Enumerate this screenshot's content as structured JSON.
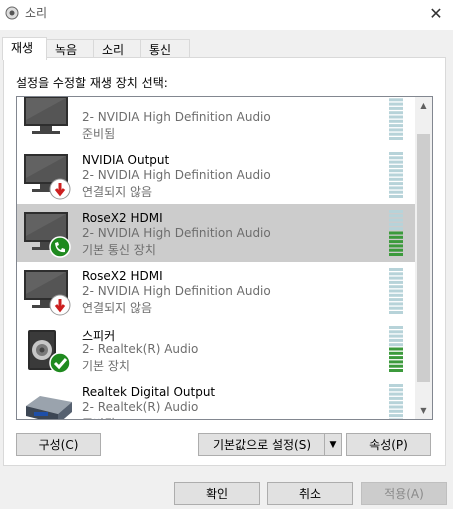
{
  "window": {
    "title": "소리"
  },
  "tabs": [
    {
      "label": "재생",
      "active": true
    },
    {
      "label": "녹음",
      "active": false
    },
    {
      "label": "소리",
      "active": false
    },
    {
      "label": "통신",
      "active": false
    }
  ],
  "prompt": "설정을 수정할 재생 장치 선택:",
  "devices": [
    {
      "name": "",
      "sub": "2- NVIDIA High Definition Audio",
      "status": "준비됨",
      "icon": "monitor-icon",
      "badge": "",
      "selected": false
    },
    {
      "name": "NVIDIA Output",
      "sub": "2- NVIDIA High Definition Audio",
      "status": "연결되지 않음",
      "icon": "monitor-icon",
      "badge": "disconnected-badge-icon",
      "selected": false
    },
    {
      "name": "RoseX2 HDMI",
      "sub": "2- NVIDIA High Definition Audio",
      "status": "기본 통신 장치",
      "icon": "monitor-icon",
      "badge": "default-communication-badge-icon",
      "selected": true
    },
    {
      "name": "RoseX2 HDMI",
      "sub": "2- NVIDIA High Definition Audio",
      "status": "연결되지 않음",
      "icon": "monitor-icon",
      "badge": "disconnected-badge-icon",
      "selected": false
    },
    {
      "name": "스피커",
      "sub": "2- Realtek(R) Audio",
      "status": "기본 장치",
      "icon": "speaker-icon",
      "badge": "default-device-badge-icon",
      "selected": false
    },
    {
      "name": "Realtek Digital Output",
      "sub": "2- Realtek(R) Audio",
      "status": "준비됨",
      "icon": "digital-output-icon",
      "badge": "",
      "selected": false
    }
  ],
  "buttons": {
    "configure": "구성(C)",
    "set_default": "기본값으로 설정(S)",
    "properties": "속성(P)",
    "ok": "확인",
    "cancel": "취소",
    "apply": "적용(A)"
  },
  "colors": {
    "selection": "#cccccc",
    "level_active": "#3c9a3c",
    "level_idle": "#b7d3d9",
    "badge_red": "#cc1f1f",
    "badge_green": "#1f8a1f"
  }
}
